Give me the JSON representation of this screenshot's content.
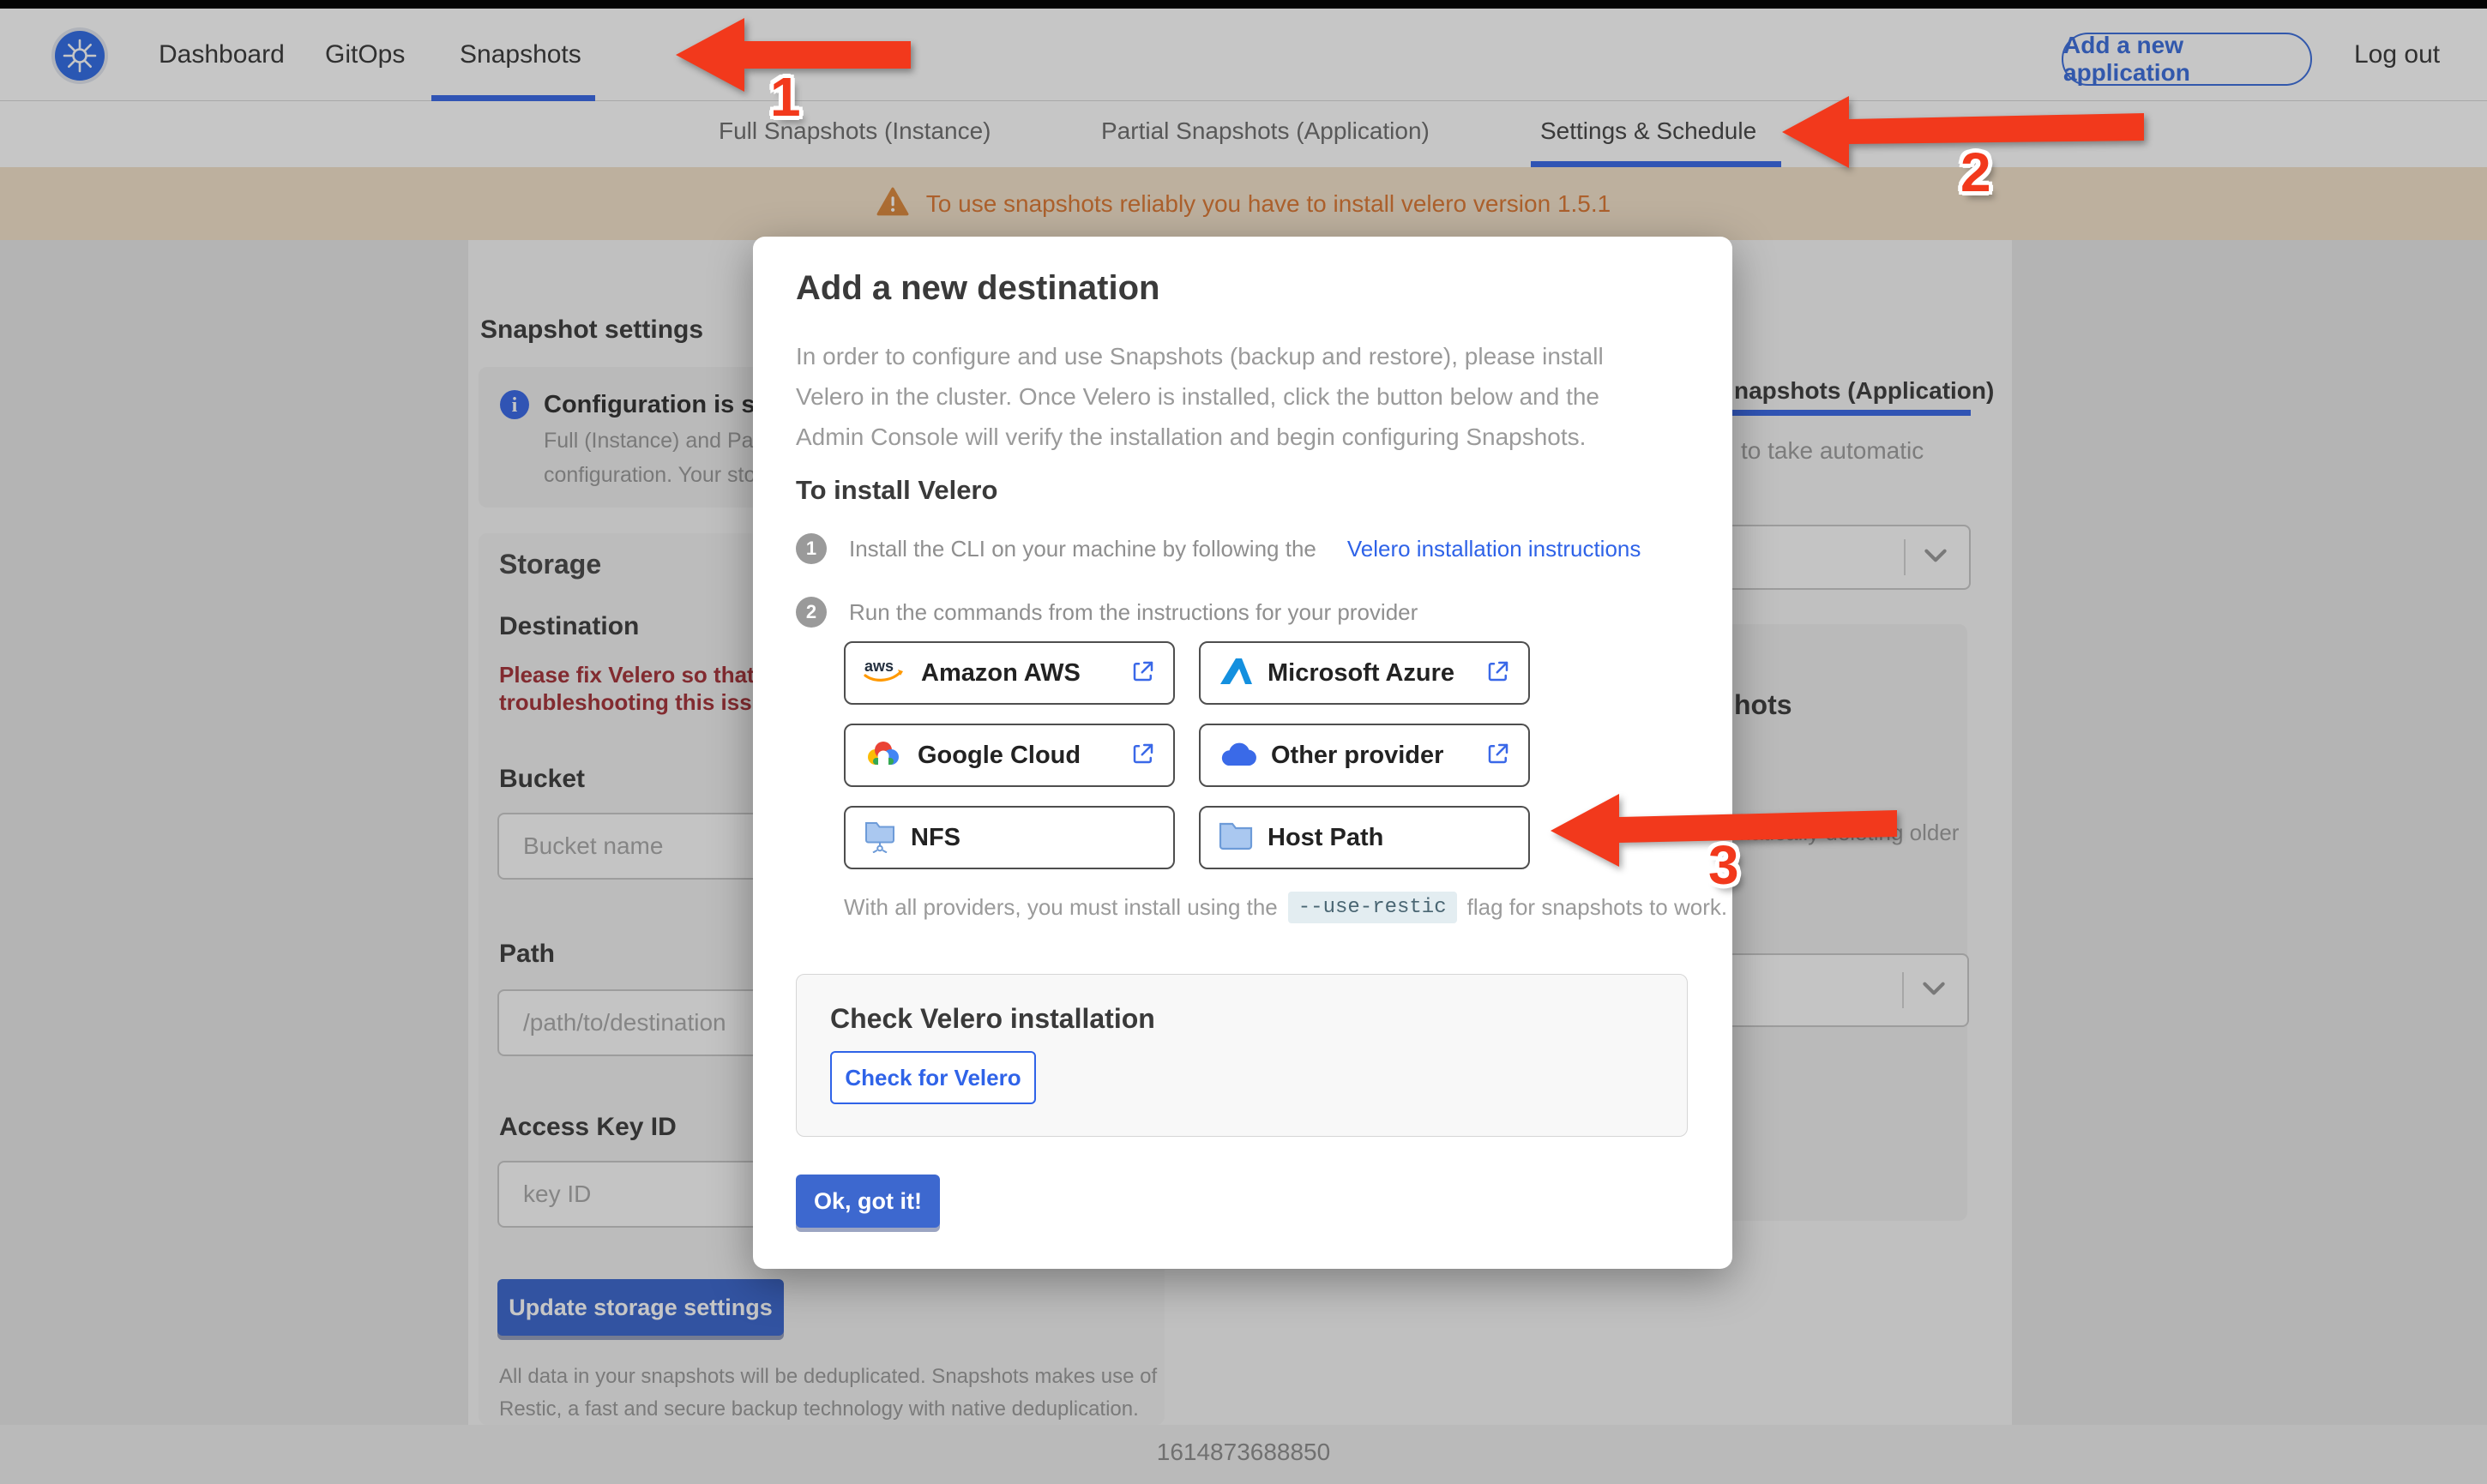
{
  "navbar": {
    "brand": "kubernetes-logo",
    "items": [
      {
        "label": "Dashboard",
        "selected": false
      },
      {
        "label": "GitOps",
        "selected": false
      },
      {
        "label": "Snapshots",
        "selected": true
      }
    ],
    "add_app_label": "Add a new application",
    "logout_label": "Log out"
  },
  "subnav": {
    "tabs": [
      {
        "label": "Full Snapshots (Instance)",
        "selected": false
      },
      {
        "label": "Partial Snapshots (Application)",
        "selected": false
      },
      {
        "label": "Settings & Schedule",
        "selected": true
      }
    ]
  },
  "banner": {
    "text": "To use snapshots reliably you have to install velero version 1.5.1"
  },
  "modal": {
    "title": "Add a new destination",
    "description": "In order to configure and use Snapshots (backup and restore), please install Velero in the cluster. Once Velero is installed, click the button below and the Admin Console will verify the installation and begin configuring Snapshots.",
    "install_heading": "To install Velero",
    "steps": [
      {
        "number": "1",
        "text": "Install the CLI on your machine by following the",
        "link": "Velero installation instructions"
      },
      {
        "number": "2",
        "text": "Run the commands from the instructions for your provider",
        "link": ""
      }
    ],
    "providers": [
      {
        "name": "Amazon AWS"
      },
      {
        "name": "Microsoft Azure"
      },
      {
        "name": "Google Cloud"
      },
      {
        "name": "Other provider"
      },
      {
        "name": "NFS"
      },
      {
        "name": "Host Path"
      }
    ],
    "restic_note_prefix": "With all providers, you must install using the",
    "restic_flag": "--use-restic",
    "restic_note_suffix": "flag for snapshots to work.",
    "check_heading": "Check Velero installation",
    "check_button": "Check for Velero",
    "ok_button": "Ok, got it!"
  },
  "page": {
    "left": {
      "section_title": "Snapshot settings",
      "info_title_fragment": "Configuration is sh",
      "info_line1_fragment": "Full (Instance) and Parti",
      "info_line2_fragment": "configuration. Your stor",
      "storage_heading": "Storage",
      "destination_label": "Destination",
      "error_line1_fragment": "Please fix Velero so that th",
      "error_line2_fragment": "troubleshooting this issue",
      "bucket_label": "Bucket",
      "bucket_placeholder": "Bucket name",
      "path_label": "Path",
      "path_placeholder": "/path/to/destination",
      "access_key_label": "Access Key ID",
      "access_key_placeholder": "key ID",
      "update_button": "Update storage settings",
      "dedup_line1": "All data in your snapshots will be deduplicated. Snapshots makes use of",
      "dedup_line2": "Restic, a fast and secure backup technology with native deduplication."
    },
    "right": {
      "tab_fragment": "napshots (Application)",
      "auto_text_fragment": "to take automatic",
      "card_heading_fragment": "hots",
      "card_text_fragment": "matically deleting older"
    },
    "footer_timestamp": "1614873688850"
  },
  "annotations": {
    "arrows": [
      {
        "label": "1"
      },
      {
        "label": "2"
      },
      {
        "label": "3"
      }
    ]
  },
  "colors": {
    "accent_blue": "#3a6ae8",
    "k8s_blue": "#326de6",
    "arrow_red": "#f2391c",
    "warning_text": "#dd7a35",
    "warning_bg": "#f3e3cb",
    "error_red": "#a6343a"
  }
}
